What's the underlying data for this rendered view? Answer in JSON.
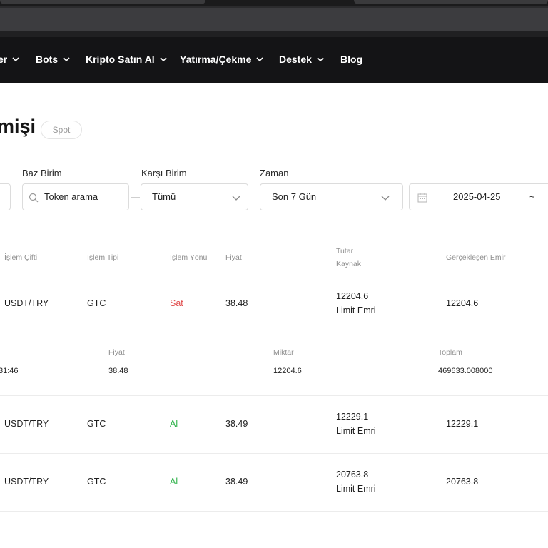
{
  "nav": {
    "items": [
      {
        "label": "er"
      },
      {
        "label": "Bots"
      },
      {
        "label": "Kripto Satın Al"
      },
      {
        "label": "Yatırma/Çekme"
      },
      {
        "label": "Destek"
      },
      {
        "label": "Blog"
      }
    ]
  },
  "page": {
    "title": "mişi",
    "badge": "Spot"
  },
  "filters": {
    "base_label": "Baz Birim",
    "base_placeholder": "Token arama",
    "quote_label": "Karşı Birim",
    "quote_value": "Tümü",
    "time_label": "Zaman",
    "time_value": "Son 7 Gün",
    "date_start": "2025-04-25",
    "date_sep": "~"
  },
  "table": {
    "headers": {
      "pair": "İşlem Çifti",
      "type": "İşlem Tipi",
      "side": "İşlem Yönü",
      "price": "Fiyat",
      "amount": "Tutar",
      "source": "Kaynak",
      "filled": "Gerçekleşen Emir"
    },
    "rows": [
      {
        "pair": "USDT/TRY",
        "type": "GTC",
        "side": "Sat",
        "price": "38.48",
        "amount": "12204.6",
        "source": "Limit Emri",
        "filled": "12204.6"
      },
      {
        "pair": "USDT/TRY",
        "type": "GTC",
        "side": "Al",
        "price": "38.49",
        "amount": "12229.1",
        "source": "Limit Emri",
        "filled": "12229.1"
      },
      {
        "pair": "USDT/TRY",
        "type": "GTC",
        "side": "Al",
        "price": "38.49",
        "amount": "20763.8",
        "source": "Limit Emri",
        "filled": "20763.8"
      }
    ],
    "detail": {
      "time": "31:46",
      "price_label": "Fiyat",
      "price": "38.48",
      "qty_label": "Miktar",
      "qty": "12204.6",
      "total_label": "Toplam",
      "total": "469633.008000"
    }
  },
  "colors": {
    "sell": "#e04b4b",
    "buy": "#2fb24a",
    "navbar": "#141416"
  }
}
